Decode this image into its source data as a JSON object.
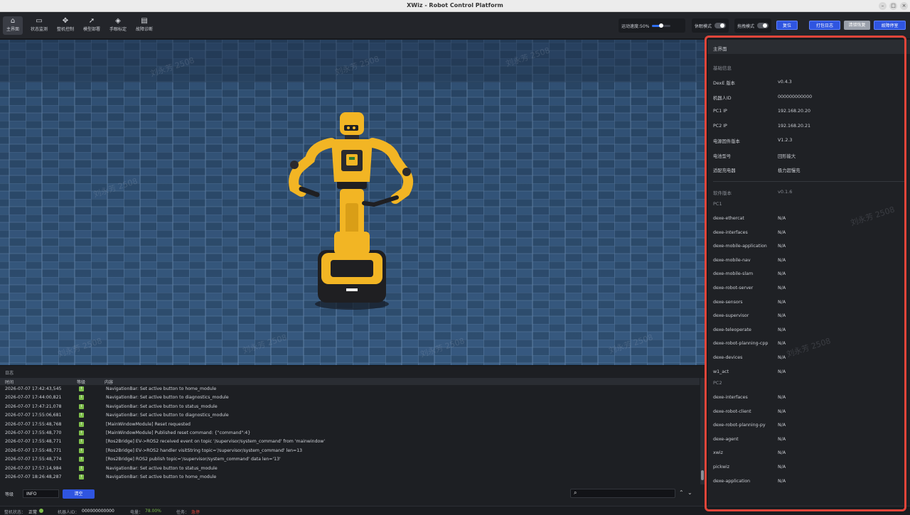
{
  "window": {
    "title": "XWiz - Robot Control Platform",
    "controls": [
      "–",
      "□",
      "×"
    ]
  },
  "nav": [
    {
      "label": "主界面",
      "icon": "home-icon",
      "glyph": "⌂"
    },
    {
      "label": "状态监测",
      "icon": "monitor-icon",
      "glyph": "▭"
    },
    {
      "label": "整机控制",
      "icon": "gamepad-icon",
      "glyph": "✥"
    },
    {
      "label": "模型部署",
      "icon": "rocket-icon",
      "glyph": "➚"
    },
    {
      "label": "手眼标定",
      "icon": "calibration-icon",
      "glyph": "◈"
    },
    {
      "label": "故障诊断",
      "icon": "diagnostics-icon",
      "glyph": "▤"
    }
  ],
  "toolbar": {
    "speed_label": "运动速度:50%",
    "speed": 0.5,
    "sleep_mode_label": "休眠模式",
    "drag_mode_label": "拖拽模式",
    "reset_label": "复位",
    "pack_log_label": "打包日志",
    "clear_fault_label": "清错恢复",
    "fault_stop_label": "故障停室"
  },
  "viewport": {
    "watermarks": [
      "刘永芳 2508",
      "刘永芳 2508",
      "刘永芳 2508",
      "刘永芳 2508",
      "刘永芳 2508",
      "刘永芳 2508",
      "刘永芳 2508",
      "刘永芳 2508"
    ]
  },
  "log": {
    "title": "日志",
    "columns": [
      "时间",
      "等级",
      "内容"
    ],
    "rows": [
      {
        "time": "2026-07-07 17:42:43,545",
        "level": "I",
        "message": "NavigationBar: Set active button to home_module"
      },
      {
        "time": "2026-07-07 17:44:00,821",
        "level": "I",
        "message": "NavigationBar: Set active button to diagnostics_module"
      },
      {
        "time": "2026-07-07 17:47:21,078",
        "level": "I",
        "message": "NavigationBar: Set active button to status_module"
      },
      {
        "time": "2026-07-07 17:55:06,681",
        "level": "I",
        "message": "NavigationBar: Set active button to diagnostics_module"
      },
      {
        "time": "2026-07-07 17:55:48,768",
        "level": "I",
        "message": "[MainWindowModule] Reset requested"
      },
      {
        "time": "2026-07-07 17:55:48,770",
        "level": "I",
        "message": "[MainWindowModule] Published reset command: {\"command\":4}"
      },
      {
        "time": "2026-07-07 17:55:48,771",
        "level": "I",
        "message": "[Ros2Bridge] EV->ROS2 received event on topic '/supervisor/system_command' from 'mainwindow'"
      },
      {
        "time": "2026-07-07 17:55:48,771",
        "level": "I",
        "message": "[Ros2Bridge] EV->ROS2 handler visitString topic='/supervisor/system_command' len=13"
      },
      {
        "time": "2026-07-07 17:55:48,774",
        "level": "I",
        "message": "[Ros2Bridge] ROS2 publish topic='/supervisor/system_command' data len='13'"
      },
      {
        "time": "2026-07-07 17:57:14,984",
        "level": "I",
        "message": "NavigationBar: Set active button to status_module"
      },
      {
        "time": "2026-07-07 18:26:48,287",
        "level": "I",
        "message": "NavigationBar: Set active button to home_module"
      }
    ],
    "level_label": "等级",
    "level_value": "INFO",
    "clear_label": "清空",
    "search_placeholder": ""
  },
  "status": {
    "machine_state_label": "整机状态：",
    "machine_state_value": "正常",
    "robot_id_label": "机器人ID：",
    "robot_id_value": "000000000000",
    "battery_label": "电量：",
    "battery_value": "78.00%",
    "task_label": "任务：",
    "task_value": "急停"
  },
  "panel": {
    "title": "主界面",
    "basic_section": "基础信息",
    "basic_rows": [
      {
        "key": "DexE 版本",
        "value": "v0.4.3"
      },
      {
        "key": "机器人ID",
        "value": "000000000000"
      },
      {
        "key": "PC1 IP",
        "value": "192.168.20.20"
      },
      {
        "key": "PC2 IP",
        "value": "192.168.20.21"
      },
      {
        "key": "电源固件版本",
        "value": "V1.2.3"
      },
      {
        "key": "电池型号",
        "value": "回形能大"
      },
      {
        "key": "适配充电器",
        "value": "极力超慢充"
      }
    ],
    "software_label": "软件版本",
    "software_value": "v0.1.6",
    "pc1_label": "PC1",
    "pc1_rows": [
      {
        "key": "dexe-ethercat",
        "value": "N/A"
      },
      {
        "key": "dexe-interfaces",
        "value": "N/A"
      },
      {
        "key": "dexe-mobile-application",
        "value": "N/A"
      },
      {
        "key": "dexe-mobile-nav",
        "value": "N/A"
      },
      {
        "key": "dexe-mobile-slam",
        "value": "N/A"
      },
      {
        "key": "dexe-robot-server",
        "value": "N/A"
      },
      {
        "key": "dexe-sensors",
        "value": "N/A"
      },
      {
        "key": "dexe-supervisor",
        "value": "N/A"
      },
      {
        "key": "dexe-teleoperate",
        "value": "N/A"
      },
      {
        "key": "dexe-robot-planning-cpp",
        "value": "N/A"
      },
      {
        "key": "dexe-devices",
        "value": "N/A"
      },
      {
        "key": "w1_act",
        "value": "N/A"
      }
    ],
    "pc2_label": "PC2",
    "pc2_rows": [
      {
        "key": "dexe-interfaces",
        "value": "N/A"
      },
      {
        "key": "dexe-robot-client",
        "value": "N/A"
      },
      {
        "key": "dexe-robot-planning-py",
        "value": "N/A"
      },
      {
        "key": "dexe-agent",
        "value": "N/A"
      },
      {
        "key": "xwiz",
        "value": "N/A"
      },
      {
        "key": "pickwiz",
        "value": "N/A"
      },
      {
        "key": "dexe-application",
        "value": "N/A"
      }
    ],
    "watermarks": [
      "刘永芳 2508",
      "刘永芳 2508"
    ]
  },
  "colors": {
    "accent": "#2f55e0",
    "highlight": "#e0453a",
    "ok": "#7fbf4b",
    "warn": "#e0453a",
    "robot": "#f2b524"
  }
}
